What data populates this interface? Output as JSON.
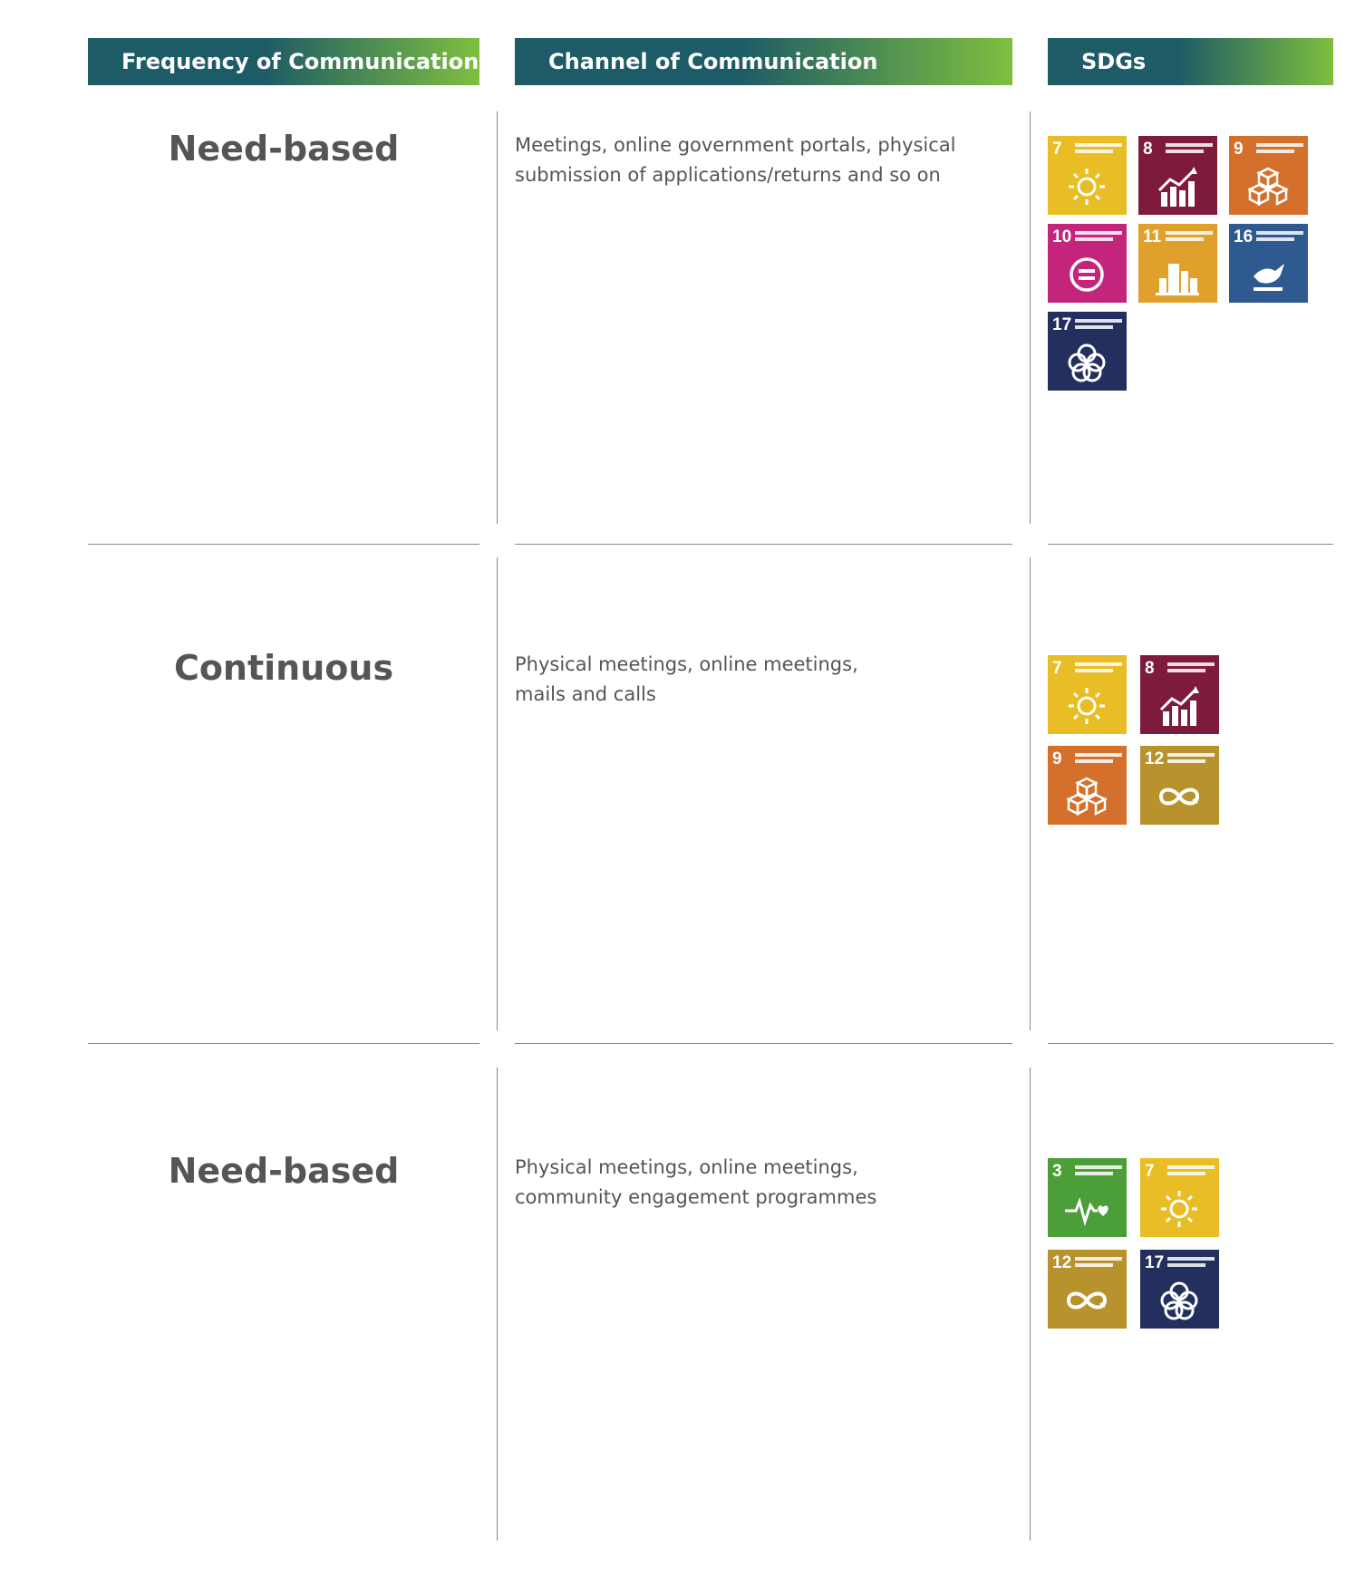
{
  "headers": {
    "frequency": "Frequency of Communication",
    "channel": "Channel of Communication",
    "sdgs": "SDGs"
  },
  "colors": {
    "header_start": "#1d5b66",
    "header_end": "#7fbf3f",
    "sdg3": "#4c9f38",
    "sdg7": "#e8bd25",
    "sdg8": "#7e1a3c",
    "sdg9": "#d4702b",
    "sdg10": "#c3257d",
    "sdg11": "#e0a12c",
    "sdg12": "#b8922d",
    "sdg16": "#2f5a8f",
    "sdg17": "#23305e"
  },
  "rows": [
    {
      "frequency": "Need-based",
      "channel_lines": [
        "Meetings, online government portals, physical",
        "submission of applications/returns and so on"
      ],
      "sdgs": [
        {
          "num": "7",
          "icon": "sun-icon",
          "color": "#e8bd25"
        },
        {
          "num": "8",
          "icon": "growth-chart-icon",
          "color": "#7e1a3c"
        },
        {
          "num": "9",
          "icon": "cubes-icon",
          "color": "#d4702b"
        },
        {
          "num": "10",
          "icon": "equality-icon",
          "color": "#c3257d"
        },
        {
          "num": "11",
          "icon": "city-icon",
          "color": "#e0a12c"
        },
        {
          "num": "16",
          "icon": "dove-icon",
          "color": "#2f5a8f"
        },
        {
          "num": "17",
          "icon": "flower-rings-icon",
          "color": "#23305e"
        }
      ]
    },
    {
      "frequency": "Continuous",
      "channel_lines": [
        "Physical meetings, online meetings,",
        "mails and calls"
      ],
      "sdgs": [
        {
          "num": "7",
          "icon": "sun-icon",
          "color": "#e8bd25"
        },
        {
          "num": "8",
          "icon": "growth-chart-icon",
          "color": "#7e1a3c"
        },
        {
          "num": "9",
          "icon": "cubes-icon",
          "color": "#d4702b"
        },
        {
          "num": "12",
          "icon": "infinity-icon",
          "color": "#b8922d"
        }
      ]
    },
    {
      "frequency": "Need-based",
      "channel_lines": [
        "Physical meetings, online meetings,",
        "community engagement programmes"
      ],
      "sdgs": [
        {
          "num": "3",
          "icon": "heartbeat-icon",
          "color": "#4c9f38"
        },
        {
          "num": "7",
          "icon": "sun-icon",
          "color": "#e8bd25"
        },
        {
          "num": "12",
          "icon": "infinity-icon",
          "color": "#b8922d"
        },
        {
          "num": "17",
          "icon": "flower-rings-icon",
          "color": "#23305e"
        }
      ]
    }
  ]
}
